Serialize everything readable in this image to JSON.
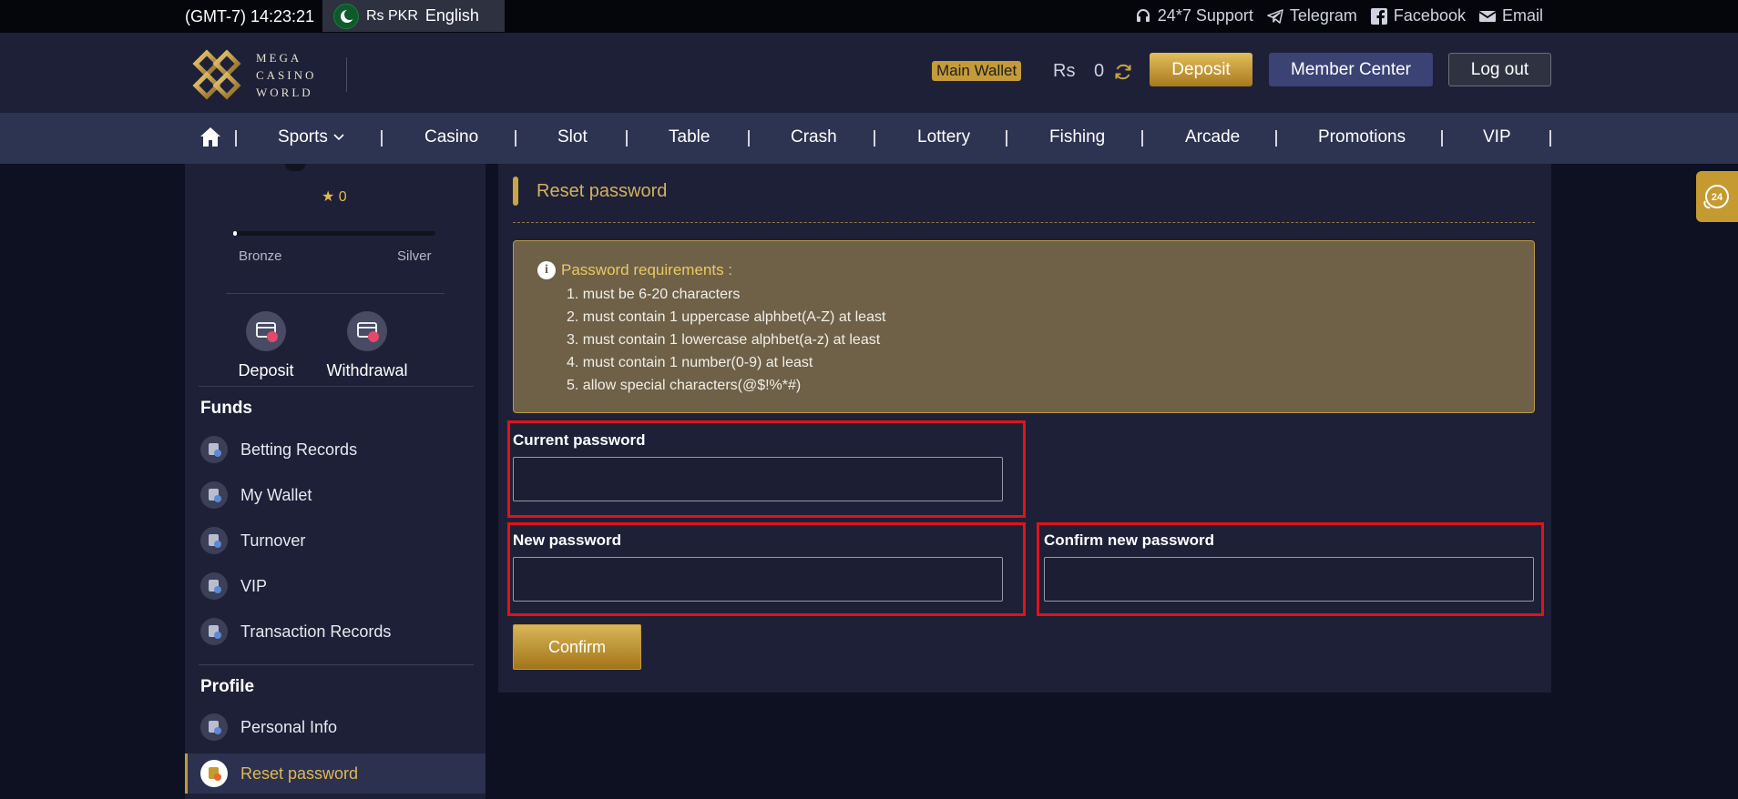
{
  "topbar": {
    "time": "(GMT-7) 14:23:21",
    "currency": "Rs PKR",
    "language": "English",
    "links": [
      {
        "label": "24*7 Support",
        "icon": "headset-icon"
      },
      {
        "label": "Telegram",
        "icon": "telegram-icon"
      },
      {
        "label": "Facebook",
        "icon": "facebook-icon"
      },
      {
        "label": "Email",
        "icon": "email-icon"
      }
    ]
  },
  "header": {
    "logo_lines": [
      "MEGA",
      "CASINO",
      "WORLD"
    ],
    "wallet_label": "Main Wallet",
    "currency_symbol": "Rs",
    "balance": "0",
    "deposit_label": "Deposit",
    "member_center_label": "Member Center",
    "logout_label": "Log out"
  },
  "nav": {
    "items": [
      "Sports",
      "Casino",
      "Slot",
      "Table",
      "Crash",
      "Lottery",
      "Fishing",
      "Arcade",
      "Promotions",
      "VIP"
    ]
  },
  "sidebar": {
    "stars": "★ 0",
    "level_from": "Bronze",
    "level_to": "Silver",
    "level_progress": 0.02,
    "quick_actions": [
      "Deposit",
      "Withdrawal"
    ],
    "funds_title": "Funds",
    "funds_items": [
      "Betting Records",
      "My Wallet",
      "Turnover",
      "VIP",
      "Transaction Records"
    ],
    "profile_title": "Profile",
    "profile_items": [
      "Personal Info",
      "Reset password"
    ]
  },
  "main": {
    "title": "Reset password",
    "requirements_title": "Password requirements :",
    "requirements": [
      "1. must be 6-20 characters",
      "2. must contain 1 uppercase alphbet(A-Z) at least",
      "3. must contain 1 lowercase alphbet(a-z) at least",
      "4. must contain 1 number(0-9) at least",
      "5. allow special characters(@$!%*#)"
    ],
    "current_password_label": "Current password",
    "current_password_value": "",
    "new_password_label": "New password",
    "new_password_value": "",
    "confirm_password_label": "Confirm new password",
    "confirm_password_value": "",
    "confirm_button": "Confirm"
  },
  "colors": {
    "accent_gold": "#c9a642",
    "highlight_red": "#e0131a",
    "panel_bg": "#1d2036"
  }
}
